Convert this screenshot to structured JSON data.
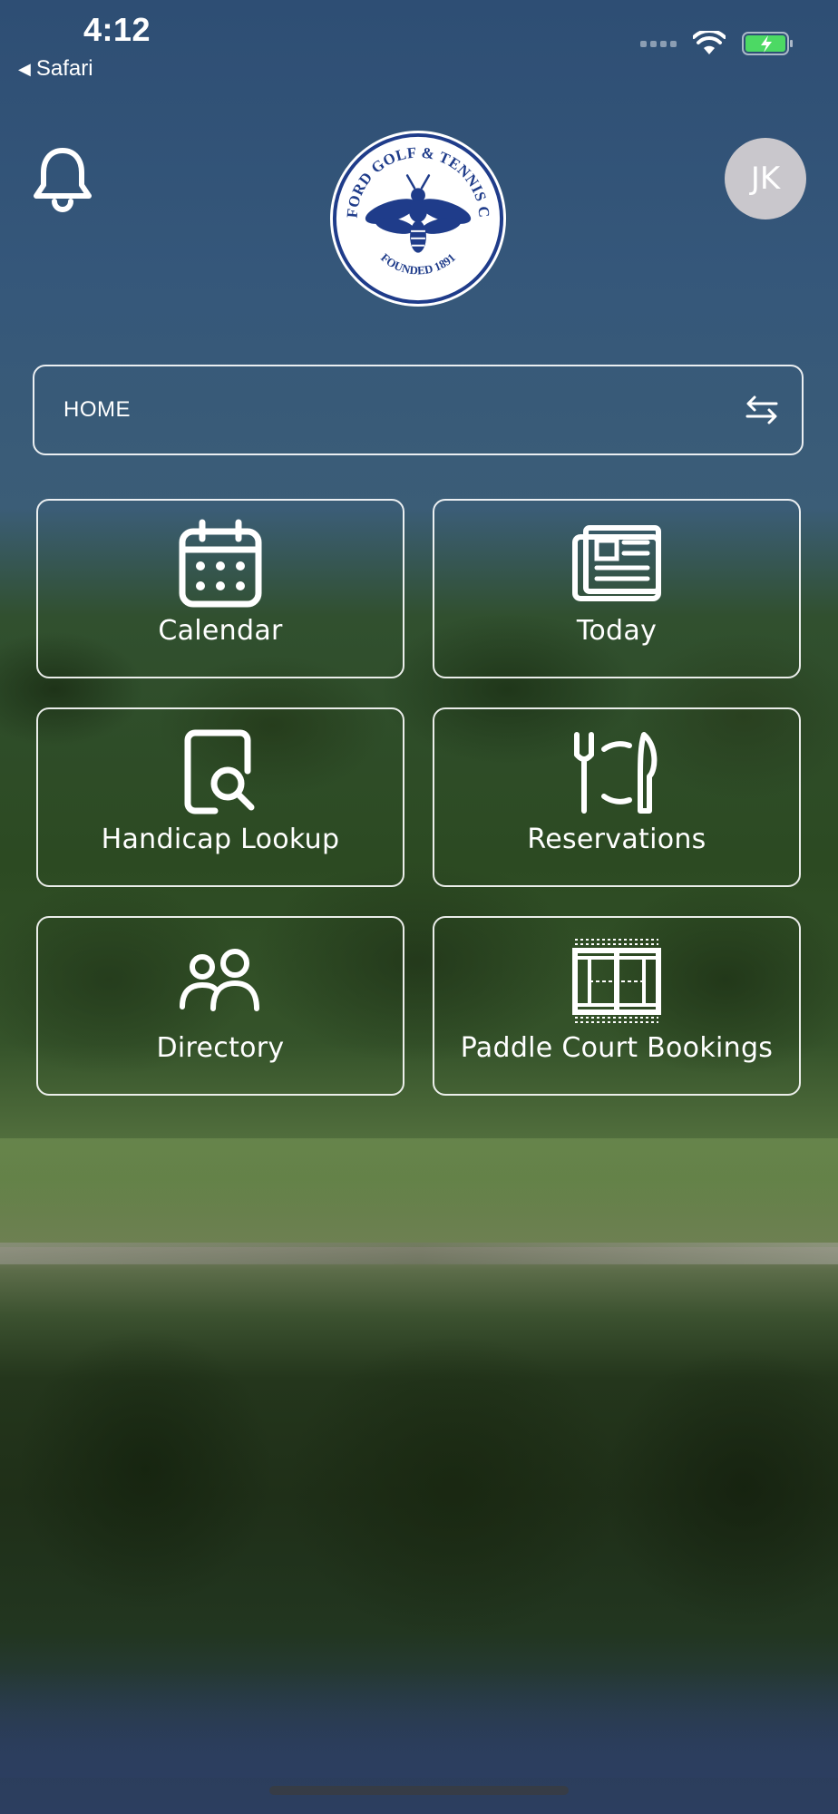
{
  "status_bar": {
    "time": "4:12",
    "back_app": "Safari"
  },
  "header": {
    "avatar_initials": "JK",
    "logo": {
      "top_arc": "BEDFORD GOLF & TENNIS CLUB",
      "bottom_arc": "FOUNDED 1891"
    }
  },
  "home_selector": {
    "label": "HOME"
  },
  "tiles": [
    {
      "label": "Calendar",
      "icon": "calendar-icon"
    },
    {
      "label": "Today",
      "icon": "newspaper-icon"
    },
    {
      "label": "Handicap Lookup",
      "icon": "document-search-icon"
    },
    {
      "label": "Reservations",
      "icon": "dining-icon"
    },
    {
      "label": "Directory",
      "icon": "people-icon"
    },
    {
      "label": "Paddle Court Bookings",
      "icon": "court-icon"
    }
  ],
  "colors": {
    "logo_blue": "#1f3c8a",
    "tile_border": "#ffffff",
    "avatar_bg": "#c9c7cc"
  }
}
